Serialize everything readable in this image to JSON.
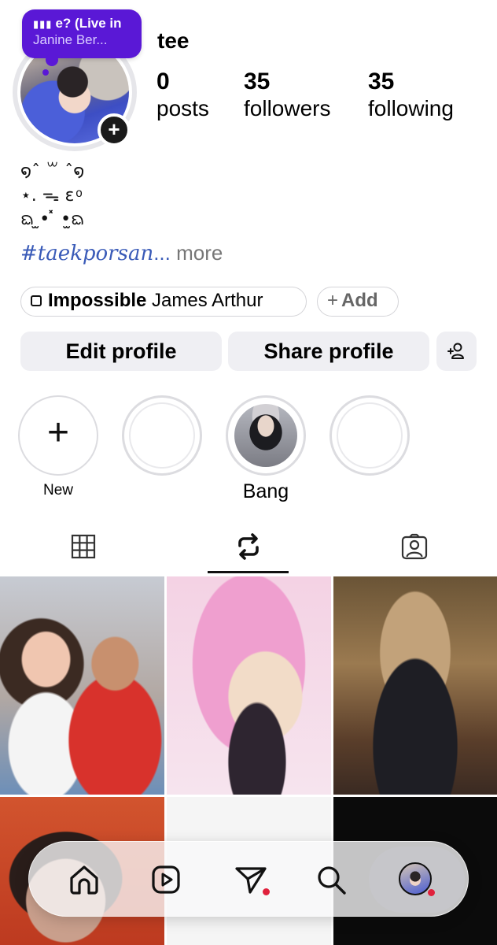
{
  "note": {
    "line1": "e? (Live in",
    "line1_icon": "audio-wave-icon",
    "line2": "Janine Ber..."
  },
  "profile": {
    "username": "tee",
    "stats": [
      {
        "value": "0",
        "label": "posts"
      },
      {
        "value": "35",
        "label": "followers"
      },
      {
        "value": "35",
        "label": "following"
      }
    ],
    "bio_lines": [
      "໑ˆ ꒳ ˆ໑",
      "⋆. ᯓ ɛ ͦ",
      "ᨳ ̫•  ̽ •̫ᨳ"
    ],
    "hashtag": "#taekporsan",
    "ellipsis": "...",
    "more": " more"
  },
  "music": {
    "title": "Impossible",
    "artist": " James Arthur",
    "add_label": "Add",
    "add_plus": "+"
  },
  "buttons": {
    "edit": "Edit profile",
    "share": "Share profile",
    "add_user_icon": "add-person-icon"
  },
  "highlights": [
    {
      "label": "New",
      "plus": "+"
    },
    {
      "label": ""
    },
    {
      "label": "Bang"
    },
    {
      "label": ""
    }
  ],
  "tabs": [
    {
      "icon": "grid-icon",
      "active": false
    },
    {
      "icon": "reposts-icon",
      "active": true
    },
    {
      "icon": "tagged-icon",
      "active": false
    }
  ],
  "nav": [
    {
      "icon": "home-icon"
    },
    {
      "icon": "reels-icon"
    },
    {
      "icon": "send-icon",
      "badge": true
    },
    {
      "icon": "search-icon"
    },
    {
      "icon": "profile-avatar",
      "active": true,
      "badge": true
    }
  ],
  "colors": {
    "note_bg": "#5a18d6",
    "hashtag": "#3a5bb8",
    "button_bg": "#efeff3",
    "badge_red": "#e0213c"
  }
}
